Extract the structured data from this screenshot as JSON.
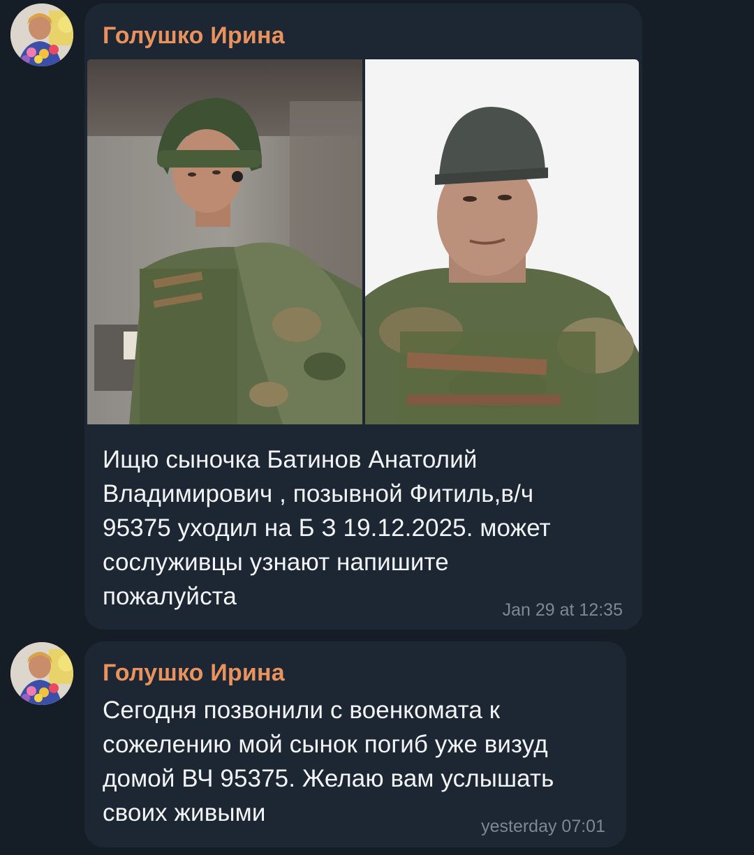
{
  "messages": [
    {
      "sender": "Голушко Ирина",
      "text": "Ищю сыночка Батинов Анатолий\nВладимирович , позывной Фитиль,в/ч\n95375  уходил на Б З 19.12.2025. может\nсослуживцы узнают напишите\nпожалуйста",
      "timestamp": "Jan 29 at 12:35",
      "photos": [
        {
          "name": "soldier-helmet-photo",
          "description": "soldier in helmet"
        },
        {
          "name": "soldier-cap-photo",
          "description": "soldier in cap"
        }
      ]
    },
    {
      "sender": "Голушко Ирина",
      "text": "Сегодня позвонили с военкомата к\nсожелению мой сынок погиб уже визуд\nдомой ВЧ 95375.  Желаю вам услышать\nсвоих живыми",
      "timestamp": "yesterday 07:01"
    }
  ],
  "colors": {
    "background": "#151e27",
    "bubble": "#1d2733",
    "sender": "#e9925d",
    "text": "#f2f4f6",
    "timestamp": "#7c8896"
  }
}
